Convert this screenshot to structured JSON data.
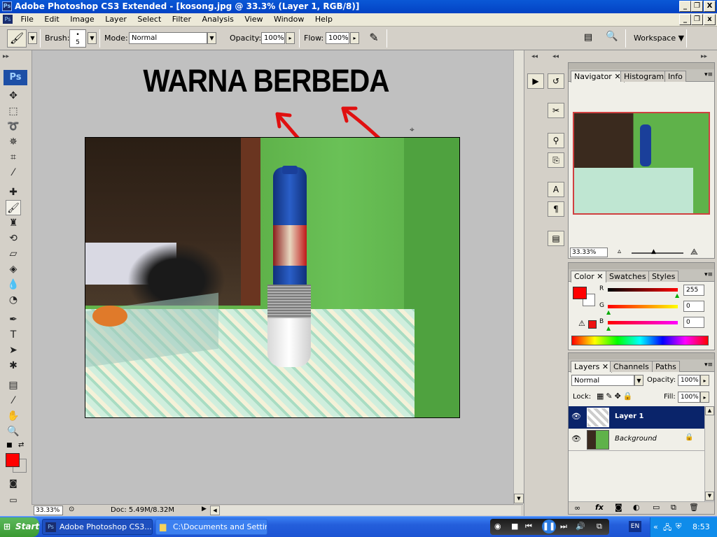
{
  "titlebar": {
    "title": "Adobe Photoshop CS3 Extended - [kosong.jpg @ 33.3% (Layer 1, RGB/8)]",
    "app_icon": "Ps",
    "minimize": "_",
    "restore": "❐",
    "close": "X"
  },
  "menu": [
    "File",
    "Edit",
    "Image",
    "Layer",
    "Select",
    "Filter",
    "Analysis",
    "View",
    "Window",
    "Help"
  ],
  "options": {
    "brush_label": "Brush:",
    "brush_size": "5",
    "mode_label": "Mode:",
    "mode_value": "Normal",
    "opacity_label": "Opacity:",
    "opacity_value": "100%",
    "flow_label": "Flow:",
    "flow_value": "100%",
    "workspace_label": "Workspace"
  },
  "toolbox": {
    "logo": "Ps"
  },
  "canvas": {
    "headline": "WARNA BERBEDA",
    "arrow_color": "#e01010"
  },
  "status": {
    "zoom": "33.33%",
    "doc": "Doc: 5.49M/8.32M"
  },
  "navigator": {
    "tabs": [
      "Navigator",
      "Histogram",
      "Info"
    ],
    "zoom": "33.33%"
  },
  "color": {
    "tabs": [
      "Color",
      "Swatches",
      "Styles"
    ],
    "r_label": "R",
    "g_label": "G",
    "b_label": "B",
    "r_value": "255",
    "g_value": "0",
    "b_value": "0",
    "foreground": "#ff0000",
    "background": "#ffffff"
  },
  "layers": {
    "tabs": [
      "Layers",
      "Channels",
      "Paths"
    ],
    "blend_mode": "Normal",
    "opacity_label": "Opacity:",
    "opacity_value": "100%",
    "lock_label": "Lock:",
    "fill_label": "Fill:",
    "fill_value": "100%",
    "items": [
      {
        "name": "Layer 1",
        "selected": true
      },
      {
        "name": "Background",
        "selected": false,
        "locked": true
      }
    ]
  },
  "taskbar": {
    "start": "Start",
    "tasks": [
      "Adobe Photoshop CS3...",
      "C:\\Documents and Settin..."
    ],
    "language": "EN",
    "time": "8:53"
  }
}
